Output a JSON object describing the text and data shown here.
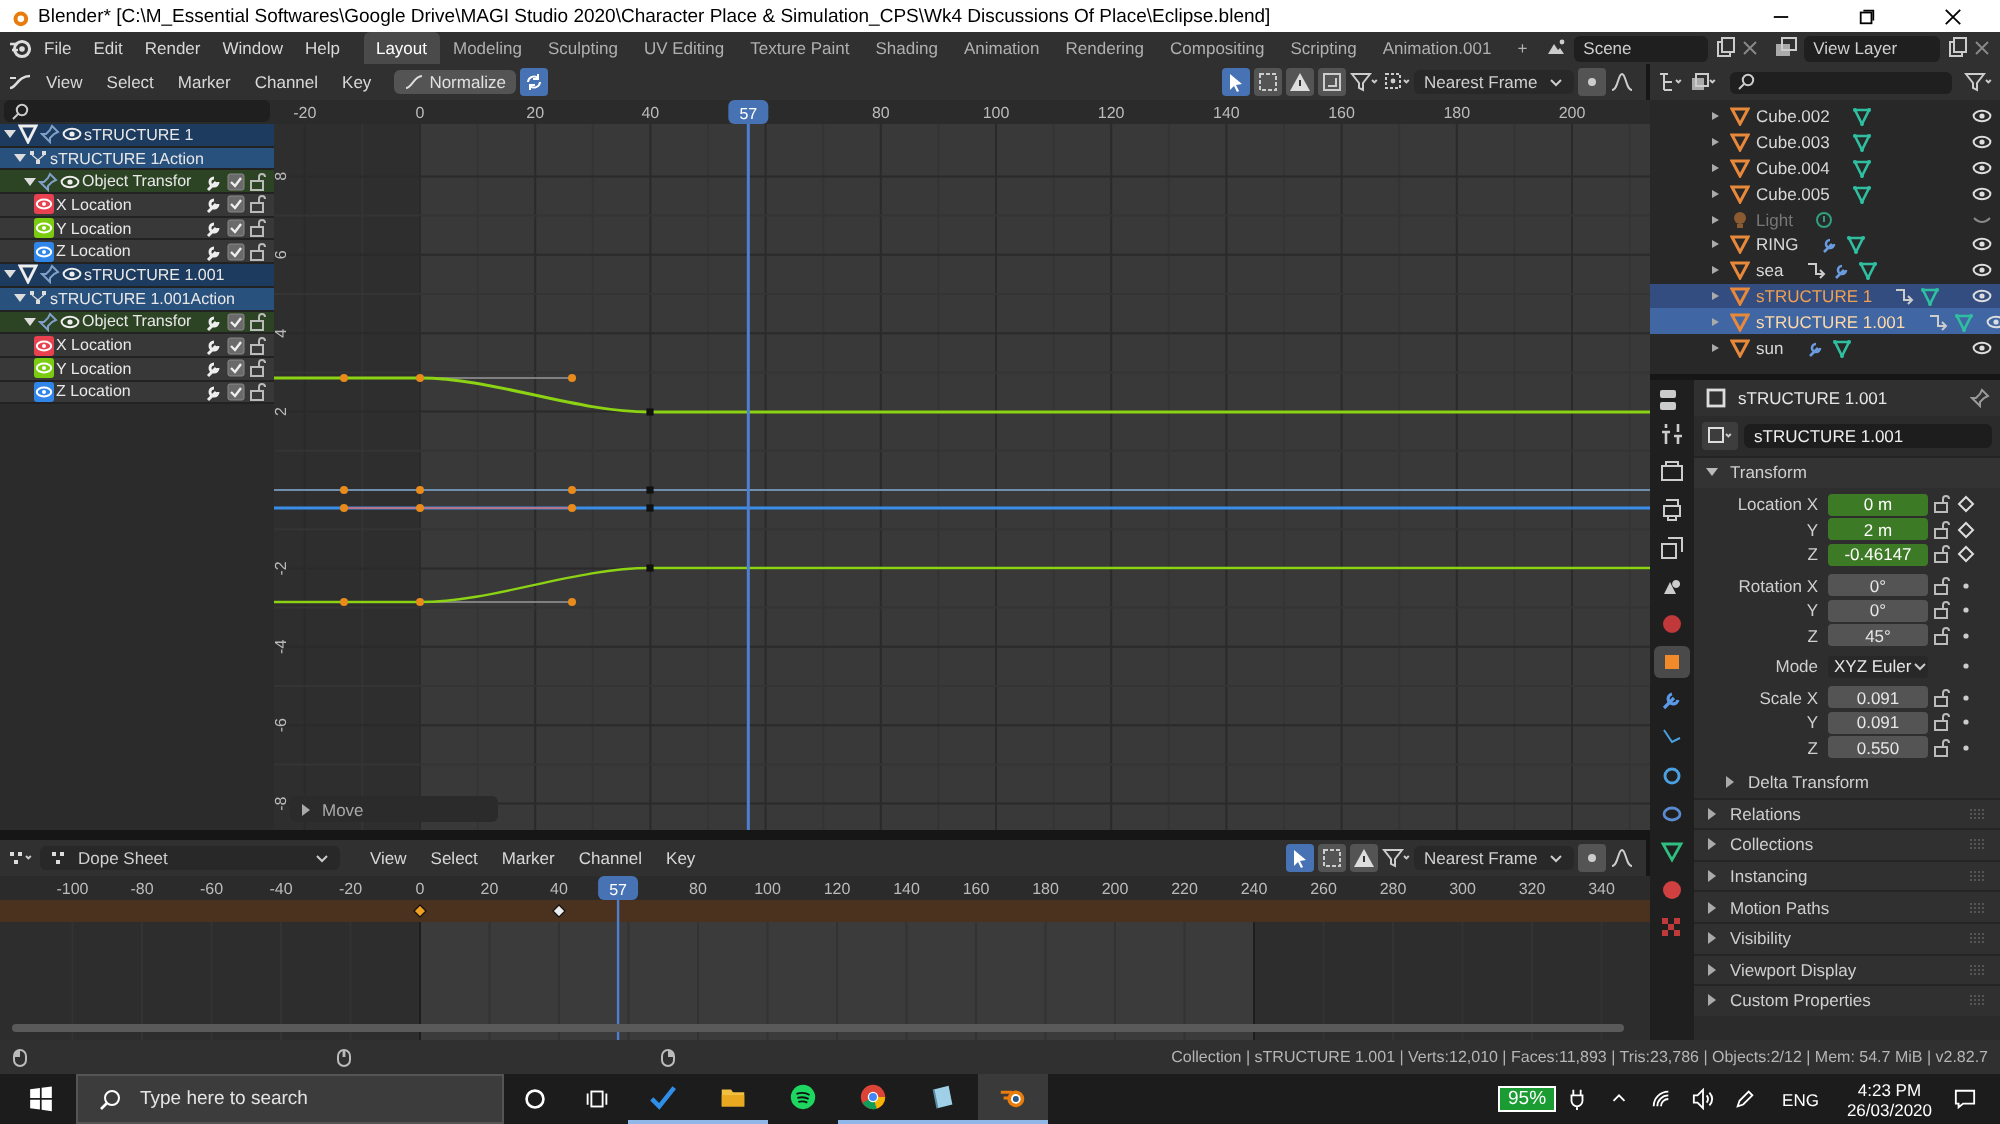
{
  "window": {
    "title": "Blender* [C:\\M_Essential Softwares\\Google Drive\\MAGI Studio 2020\\Character Place & Simulation_CPS\\Wk4 Discussions Of Place\\Eclipse.blend]"
  },
  "menu": [
    "File",
    "Edit",
    "Render",
    "Window",
    "Help"
  ],
  "workspaces": [
    {
      "label": "Layout",
      "selected": true
    },
    {
      "label": "Modeling",
      "selected": false
    },
    {
      "label": "Sculpting",
      "selected": false
    },
    {
      "label": "UV Editing",
      "selected": false
    },
    {
      "label": "Texture Paint",
      "selected": false
    },
    {
      "label": "Shading",
      "selected": false
    },
    {
      "label": "Animation",
      "selected": false
    },
    {
      "label": "Rendering",
      "selected": false
    },
    {
      "label": "Compositing",
      "selected": false
    },
    {
      "label": "Scripting",
      "selected": false
    },
    {
      "label": "Animation.001",
      "selected": false
    }
  ],
  "add_workspace": "+",
  "scene": "Scene",
  "view_layer": "View Layer",
  "graph_editor": {
    "menu": [
      "View",
      "Select",
      "Marker",
      "Channel",
      "Key"
    ],
    "normalize": {
      "label": "Normalize",
      "on": false
    },
    "snap": "Nearest Frame",
    "frame_labels": [
      "-20",
      "0",
      "20",
      "40",
      "80",
      "100",
      "120",
      "140",
      "160",
      "180",
      "200"
    ],
    "value_labels": [
      "8",
      "6",
      "4",
      "2",
      "-2",
      "-4",
      "-6",
      "-8"
    ],
    "current_frame": "57",
    "channels": [
      {
        "name": "sTRUCTURE 1",
        "kind": "object",
        "children": [
          {
            "name": "sTRUCTURE 1Action",
            "kind": "action",
            "children": [
              {
                "name": "Object Transfor",
                "kind": "group",
                "checked": true,
                "children": [
                  {
                    "name": "X Location",
                    "kind": "fcurve",
                    "color": "#e8414f",
                    "checked": true
                  },
                  {
                    "name": "Y Location",
                    "kind": "fcurve",
                    "color": "#7bcc10",
                    "checked": true
                  },
                  {
                    "name": "Z Location",
                    "kind": "fcurve",
                    "color": "#2f86e8",
                    "checked": true
                  }
                ]
              }
            ]
          }
        ]
      },
      {
        "name": "sTRUCTURE 1.001",
        "kind": "object",
        "children": [
          {
            "name": "sTRUCTURE 1.001Action",
            "kind": "action",
            "children": [
              {
                "name": "Object Transfor",
                "kind": "group",
                "checked": true,
                "children": [
                  {
                    "name": "X Location",
                    "kind": "fcurve",
                    "color": "#e8414f",
                    "checked": true
                  },
                  {
                    "name": "Y Location",
                    "kind": "fcurve",
                    "color": "#7bcc10",
                    "checked": true
                  },
                  {
                    "name": "Z Location",
                    "kind": "fcurve",
                    "color": "#2f86e8",
                    "checked": true
                  }
                ]
              }
            ]
          }
        ]
      }
    ],
    "operator_panel": {
      "label": "Move",
      "expanded": false
    }
  },
  "dope_sheet": {
    "mode": "Dope Sheet",
    "menu": [
      "View",
      "Select",
      "Marker",
      "Channel",
      "Key"
    ],
    "snap": "Nearest Frame",
    "frame_labels": [
      "-100",
      "-80",
      "-60",
      "-40",
      "-20",
      "0",
      "20",
      "40",
      "80",
      "100",
      "120",
      "140",
      "160",
      "180",
      "200",
      "220",
      "240",
      "260",
      "280",
      "300",
      "320",
      "340"
    ],
    "current_frame": "57",
    "keyframes": [
      {
        "selected": true
      },
      {
        "selected": false
      }
    ]
  },
  "outliner": {
    "items": [
      {
        "name": "Cube.002",
        "kind": "mesh",
        "selected": false,
        "active": false,
        "visible": true,
        "extras": [
          {
            "kind": "mesh-data"
          }
        ]
      },
      {
        "name": "Cube.003",
        "kind": "mesh",
        "selected": false,
        "active": false,
        "visible": true,
        "extras": [
          {
            "kind": "mesh-data"
          }
        ]
      },
      {
        "name": "Cube.004",
        "kind": "mesh",
        "selected": false,
        "active": false,
        "visible": true,
        "extras": [
          {
            "kind": "mesh-data"
          }
        ]
      },
      {
        "name": "Cube.005",
        "kind": "mesh",
        "selected": false,
        "active": false,
        "visible": true,
        "extras": [
          {
            "kind": "mesh-data"
          }
        ]
      },
      {
        "name": "Light",
        "kind": "light",
        "selected": false,
        "active": false,
        "visible": false,
        "extras": [
          {
            "kind": "light-data"
          }
        ]
      },
      {
        "name": "RING",
        "kind": "mesh",
        "selected": false,
        "active": false,
        "visible": true,
        "extras": [
          {
            "kind": "wrench"
          },
          {
            "kind": "mesh-data"
          }
        ]
      },
      {
        "name": "sea",
        "kind": "mesh",
        "selected": false,
        "active": false,
        "visible": true,
        "extras": [
          {
            "kind": "constraint"
          },
          {
            "kind": "wrench"
          },
          {
            "kind": "mesh-data"
          }
        ]
      },
      {
        "name": "sTRUCTURE 1",
        "kind": "mesh",
        "selected": true,
        "active": false,
        "visible": true,
        "extras": [
          {
            "kind": "constraint"
          },
          {
            "kind": "mesh-data"
          }
        ]
      },
      {
        "name": "sTRUCTURE 1.001",
        "kind": "mesh",
        "selected": true,
        "active": true,
        "visible": true,
        "extras": [
          {
            "kind": "constraint"
          },
          {
            "kind": "mesh-data"
          }
        ]
      },
      {
        "name": "sun",
        "kind": "mesh",
        "selected": false,
        "active": false,
        "visible": true,
        "extras": [
          {
            "kind": "wrench"
          },
          {
            "kind": "mesh-data"
          }
        ]
      }
    ]
  },
  "properties": {
    "object": "sTRUCTURE 1.001",
    "name": "sTRUCTURE 1.001",
    "tabs": [
      {
        "kind": "tool",
        "selected": false
      },
      {
        "kind": "render",
        "selected": false
      },
      {
        "kind": "output",
        "selected": false
      },
      {
        "kind": "view-layer",
        "selected": false
      },
      {
        "kind": "scene",
        "selected": false
      },
      {
        "kind": "world",
        "selected": false
      },
      {
        "kind": "object",
        "selected": true
      },
      {
        "kind": "modifier",
        "selected": false
      },
      {
        "kind": "particles",
        "selected": false
      },
      {
        "kind": "physics",
        "selected": false
      },
      {
        "kind": "constraint",
        "selected": false
      },
      {
        "kind": "data",
        "selected": false
      },
      {
        "kind": "material",
        "selected": false
      },
      {
        "kind": "texture",
        "selected": false
      }
    ],
    "transform": {
      "label": "Transform",
      "expanded": true,
      "groups": [
        [
          {
            "label": "Location X",
            "value": "0 m",
            "kind": "number",
            "animated": true
          },
          {
            "label": "Y",
            "value": "2 m",
            "kind": "number",
            "animated": true
          },
          {
            "label": "Z",
            "value": "-0.46147",
            "kind": "number",
            "animated": true
          }
        ],
        [
          {
            "label": "Rotation X",
            "value": "0°",
            "kind": "number",
            "animated": false
          },
          {
            "label": "Y",
            "value": "0°",
            "kind": "number",
            "animated": false
          },
          {
            "label": "Z",
            "value": "45°",
            "kind": "number",
            "animated": false
          }
        ],
        [
          {
            "label": "Mode",
            "value": "XYZ Euler",
            "kind": "dropdown",
            "animated": false
          }
        ],
        [
          {
            "label": "Scale X",
            "value": "0.091",
            "kind": "number",
            "animated": false
          },
          {
            "label": "Y",
            "value": "0.091",
            "kind": "number",
            "animated": false
          },
          {
            "label": "Z",
            "value": "0.550",
            "kind": "number",
            "animated": false
          }
        ]
      ],
      "subpanel": {
        "label": "Delta Transform",
        "expanded": false
      }
    },
    "sections": [
      {
        "label": "Relations",
        "expanded": false
      },
      {
        "label": "Collections",
        "expanded": false
      },
      {
        "label": "Instancing",
        "expanded": false
      },
      {
        "label": "Motion Paths",
        "expanded": false
      },
      {
        "label": "Visibility",
        "expanded": false
      },
      {
        "label": "Viewport Display",
        "expanded": false
      },
      {
        "label": "Custom Properties",
        "expanded": false
      }
    ]
  },
  "status_bar": "Collection | sTRUCTURE 1.001 | Verts:12,010 | Faces:11,893 | Tris:23,786 | Objects:2/12 | Mem: 54.7 MiB | v2.82.7",
  "taskbar": {
    "search": {
      "placeholder": "Type here to search"
    },
    "apps": [
      {
        "kind": "check",
        "running": true,
        "active": false
      },
      {
        "kind": "folder",
        "running": true,
        "active": false
      },
      {
        "kind": "music",
        "running": false,
        "active": false
      },
      {
        "kind": "browser",
        "running": true,
        "active": false
      },
      {
        "kind": "notebook",
        "running": true,
        "active": false
      },
      {
        "kind": "blender",
        "running": true,
        "active": true
      }
    ],
    "battery": "95%",
    "language": "ENG",
    "time": "4:23 PM",
    "date": "26/03/2020"
  }
}
